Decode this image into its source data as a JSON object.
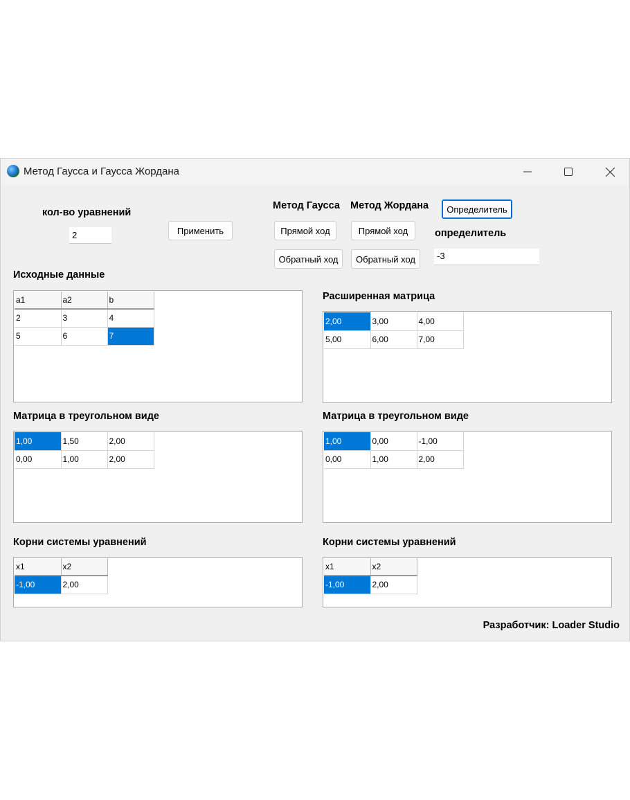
{
  "window": {
    "title": "Метод Гаусса и Гаусса Жордана",
    "controls": [
      "minimize-icon",
      "maximize-icon",
      "close-icon"
    ]
  },
  "top": {
    "count_label": "кол-во уравнений",
    "count_value": "2",
    "apply_button": "Применить",
    "gauss_label": "Метод Гаусса",
    "jordan_label": "Метод Жордана",
    "gauss_forward": "Прямой ход",
    "gauss_backward": "Обратный ход",
    "jordan_forward": "Прямой ход",
    "jordan_backward": "Обратный ход",
    "determinant_button": "Определитель",
    "determinant_label": "определитель",
    "determinant_value": "-3"
  },
  "source": {
    "label": "Исходные данные",
    "headers": [
      "a1",
      "a2",
      "b"
    ],
    "rows": [
      [
        "2",
        "3",
        "4"
      ],
      [
        "5",
        "6",
        "7"
      ]
    ]
  },
  "extended": {
    "label": "Расширенная матрица",
    "rows": [
      [
        "2,00",
        "3,00",
        "4,00"
      ],
      [
        "5,00",
        "6,00",
        "7,00"
      ]
    ]
  },
  "tri_left": {
    "label": "Матрица в треугольном виде",
    "rows": [
      [
        "1,00",
        "1,50",
        "2,00"
      ],
      [
        "0,00",
        "1,00",
        "2,00"
      ]
    ]
  },
  "tri_right": {
    "label": "Матрица в треугольном виде",
    "rows": [
      [
        "1,00",
        "0,00",
        "-1,00"
      ],
      [
        "0,00",
        "1,00",
        "2,00"
      ]
    ]
  },
  "roots_left": {
    "label": "Корни системы уравнений",
    "headers": [
      "x1",
      "x2"
    ],
    "rows": [
      [
        "-1,00",
        "2,00"
      ]
    ]
  },
  "roots_right": {
    "label": "Корни системы уравнений",
    "headers": [
      "x1",
      "x2"
    ],
    "rows": [
      [
        "-1,00",
        "2,00"
      ]
    ]
  },
  "footer": {
    "developer": "Разработчик: Loader Studio"
  },
  "colors": {
    "selection": "#0078d7",
    "window_bg": "#f0f0f0"
  }
}
